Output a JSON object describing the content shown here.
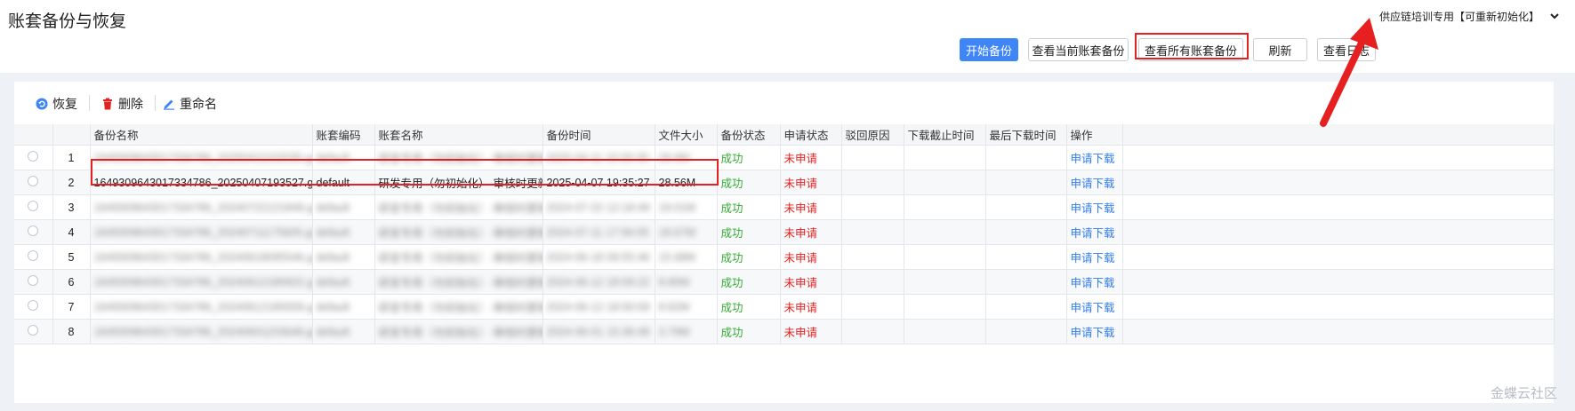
{
  "page": {
    "title": "账套备份与恢复"
  },
  "org_select": {
    "value": "供应链培训专用【可重新初始化】"
  },
  "actions": {
    "start_backup": "开始备份",
    "view_current": "查看当前账套备份",
    "view_all": "查看所有账套备份",
    "refresh": "刷新",
    "view_log": "查看日志"
  },
  "toolbar": {
    "restore": "恢复",
    "delete": "删除",
    "rename": "重命名"
  },
  "table": {
    "headers": [
      "备份名称",
      "账套编码",
      "账套名称",
      "备份时间",
      "文件大小",
      "备份状态",
      "申请状态",
      "驳回原因",
      "下载截止时间",
      "最后下载时间",
      "操作"
    ],
    "rows": [
      {
        "idx": "1",
        "name": "1649309643017334786_20250411102035.gz",
        "code": "default",
        "acct": "研发专用（勿初始化）-审核时更新",
        "time": "2025-04-11 10:20:35",
        "size": "28.6M",
        "status": "成功",
        "apply": "未申请",
        "op": "申请下载"
      },
      {
        "idx": "2",
        "name": "1649309643017334786_20250407193527.gz",
        "code": "default",
        "acct": "研发专用（勿初始化）-审核时更新",
        "time": "2025-04-07 19:35:27",
        "size": "28.56M",
        "status": "成功",
        "apply": "未申请",
        "op": "申请下载"
      },
      {
        "idx": "3",
        "name": "1649309643017334786_20240722121849.gz",
        "code": "default",
        "acct": "研发专用（勿初始化）-审核时更新",
        "time": "2024-07-22 12:18:49",
        "size": "19.01M",
        "status": "成功",
        "apply": "未申请",
        "op": "申请下载"
      },
      {
        "idx": "4",
        "name": "1649309643017334786_20240711175605.gz",
        "code": "default",
        "acct": "研发专用（勿初始化）-审核时更新",
        "time": "2024-07-11 17:56:05",
        "size": "18.67M",
        "status": "成功",
        "apply": "未申请",
        "op": "申请下载"
      },
      {
        "idx": "5",
        "name": "1649309643017334786_20240618095546.gz",
        "code": "default",
        "acct": "研发专用（勿初始化）-审核时更新",
        "time": "2024-06-18 09:55:46",
        "size": "15.68M",
        "status": "成功",
        "apply": "未申请",
        "op": "申请下载"
      },
      {
        "idx": "6",
        "name": "1649309643017334786_20240612180922.gz",
        "code": "default",
        "acct": "研发专用（勿初始化）-审核时更新",
        "time": "2024-06-12 18:09:22",
        "size": "8.85M",
        "status": "成功",
        "apply": "未申请",
        "op": "申请下载"
      },
      {
        "idx": "7",
        "name": "1649309643017334786_20240612180009.gz",
        "code": "default",
        "acct": "研发专用（勿初始化）-审核时更新",
        "time": "2024-06-12 18:00:09",
        "size": "8.82M",
        "status": "成功",
        "apply": "未申请",
        "op": "申请下载"
      },
      {
        "idx": "8",
        "name": "1649309643017334786_20240601153648.gz",
        "code": "default",
        "acct": "研发专用（勿初始化）-审核时更新",
        "time": "2024-06-01 15:36:48",
        "size": "3.79M",
        "status": "成功",
        "apply": "未申请",
        "op": "申请下载"
      }
    ]
  },
  "watermark": "金蝶云社区",
  "colors": {
    "primary": "#3e86f5",
    "success": "#33aa33",
    "danger": "#e62020",
    "link": "#2f7df0",
    "highlight": "#e62020"
  }
}
